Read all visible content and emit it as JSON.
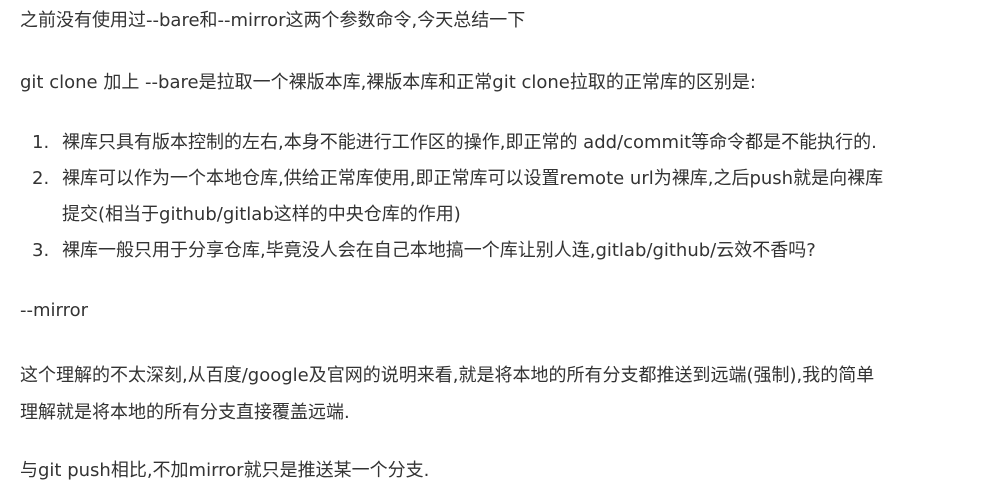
{
  "intro": "之前没有使用过--bare和--mirror这两个参数命令,今天总结一下",
  "bare_intro": "git clone 加上 --bare是拉取一个裸版本库,裸版本库和正常git clone拉取的正常库的区别是:",
  "list": [
    {
      "num": "1.",
      "text": "裸库只具有版本控制的左右,本身不能进行工作区的操作,即正常的 add/commit等命令都是不能执行的."
    },
    {
      "num": "2.",
      "text": "裸库可以作为一个本地仓库,供给正常库使用,即正常库可以设置remote url为裸库,之后push就是向裸库",
      "text2": "提交(相当于github/gitlab这样的中央仓库的作用)"
    },
    {
      "num": "3.",
      "text": "裸库一般只用于分享仓库,毕竟没人会在自己本地搞一个库让别人连,gitlab/github/云效不香吗?"
    }
  ],
  "mirror_heading": "--mirror",
  "mirror_line1": "这个理解的不太深刻,从百度/google及官网的说明来看,就是将本地的所有分支都推送到远端(强制),我的简单",
  "mirror_line2": "理解就是将本地的所有分支直接覆盖远端.",
  "push_compare": "与git push相比,不加mirror就只是推送某一个分支."
}
